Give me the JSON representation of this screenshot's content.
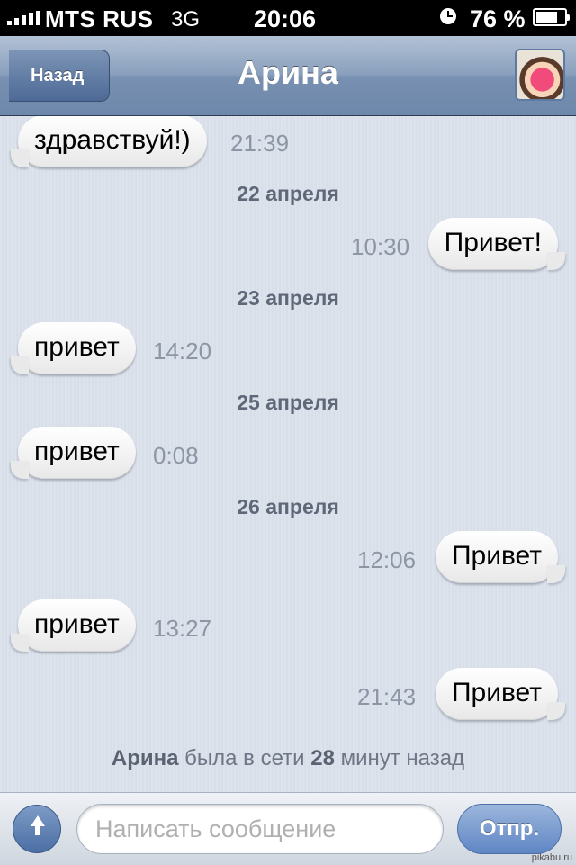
{
  "status_bar": {
    "carrier": "MTS RUS",
    "network": "3G",
    "time": "20:06",
    "battery_percent": "76 %",
    "battery_level": 0.76,
    "icons": [
      "signal-bars-icon",
      "rotation-lock-icon",
      "battery-icon"
    ]
  },
  "nav": {
    "back_label": "Назад",
    "title": "Арина"
  },
  "conversation": {
    "messages": [
      {
        "direction": "in",
        "text": "здравствуй!)",
        "time": "21:39"
      },
      {
        "direction": "out",
        "text": "Привет!",
        "time": "10:30"
      },
      {
        "direction": "in",
        "text": "привет",
        "time": "14:20"
      },
      {
        "direction": "in",
        "text": "привет",
        "time": "0:08"
      },
      {
        "direction": "out",
        "text": "Привет",
        "time": "12:06"
      },
      {
        "direction": "in",
        "text": "привет",
        "time": "13:27"
      },
      {
        "direction": "out",
        "text": "Привет",
        "time": "21:43"
      }
    ],
    "date_separators": [
      "22 апреля",
      "23 апреля",
      "25 апреля",
      "26 апреля"
    ],
    "last_seen": {
      "name": "Арина",
      "text1": "была в сети",
      "minutes": "28",
      "text2": "минут назад"
    }
  },
  "input_bar": {
    "placeholder": "Написать сообщение",
    "value": "",
    "send_label": "Отпр."
  },
  "watermark": "pikabu.ru"
}
